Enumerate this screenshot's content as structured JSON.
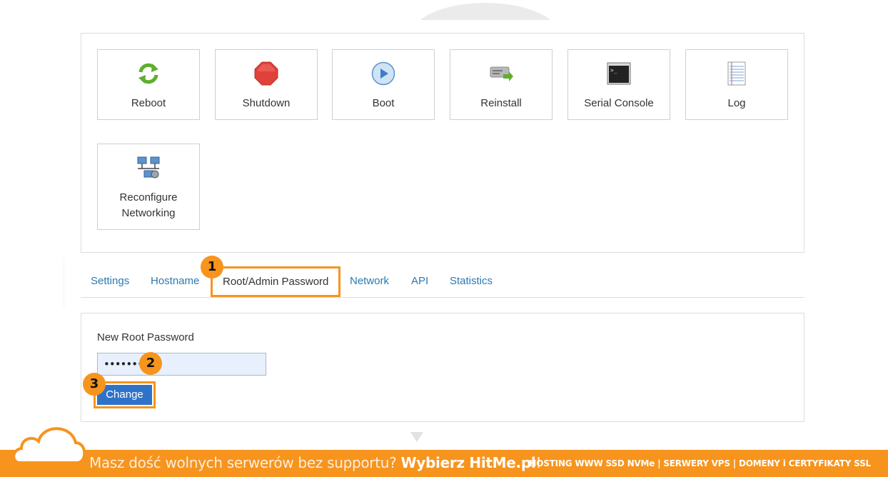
{
  "actions": [
    {
      "label": "Reboot",
      "icon": "reboot-icon"
    },
    {
      "label": "Shutdown",
      "icon": "shutdown-icon"
    },
    {
      "label": "Boot",
      "icon": "boot-icon"
    },
    {
      "label": "Reinstall",
      "icon": "reinstall-icon"
    },
    {
      "label": "Serial Console",
      "icon": "serial-console-icon"
    },
    {
      "label": "Log",
      "icon": "log-icon"
    },
    {
      "label": "Reconfigure Networking",
      "icon": "network-config-icon"
    }
  ],
  "tabs": [
    {
      "label": "Settings"
    },
    {
      "label": "Hostname"
    },
    {
      "label": "Root/Admin Password",
      "active": true
    },
    {
      "label": "Network"
    },
    {
      "label": "API"
    },
    {
      "label": "Statistics"
    }
  ],
  "form": {
    "label": "New Root Password",
    "password_value": "••••••••",
    "submit_label": "Change"
  },
  "steps": [
    "1",
    "2",
    "3"
  ],
  "banner": {
    "text_prefix": "Masz dość wolnych serwerów bez supportu? ",
    "text_bold": "Wybierz HitMe.pl",
    "text_suffix": "!",
    "right_text": "HOSTING WWW SSD NVMe | SERWERY VPS | DOMENY i CERTYFIKATY SSL"
  },
  "colors": {
    "accent": "#f7941d",
    "link": "#2a7ab0",
    "button": "#2f73c9",
    "input_bg": "#e8f0fe"
  }
}
